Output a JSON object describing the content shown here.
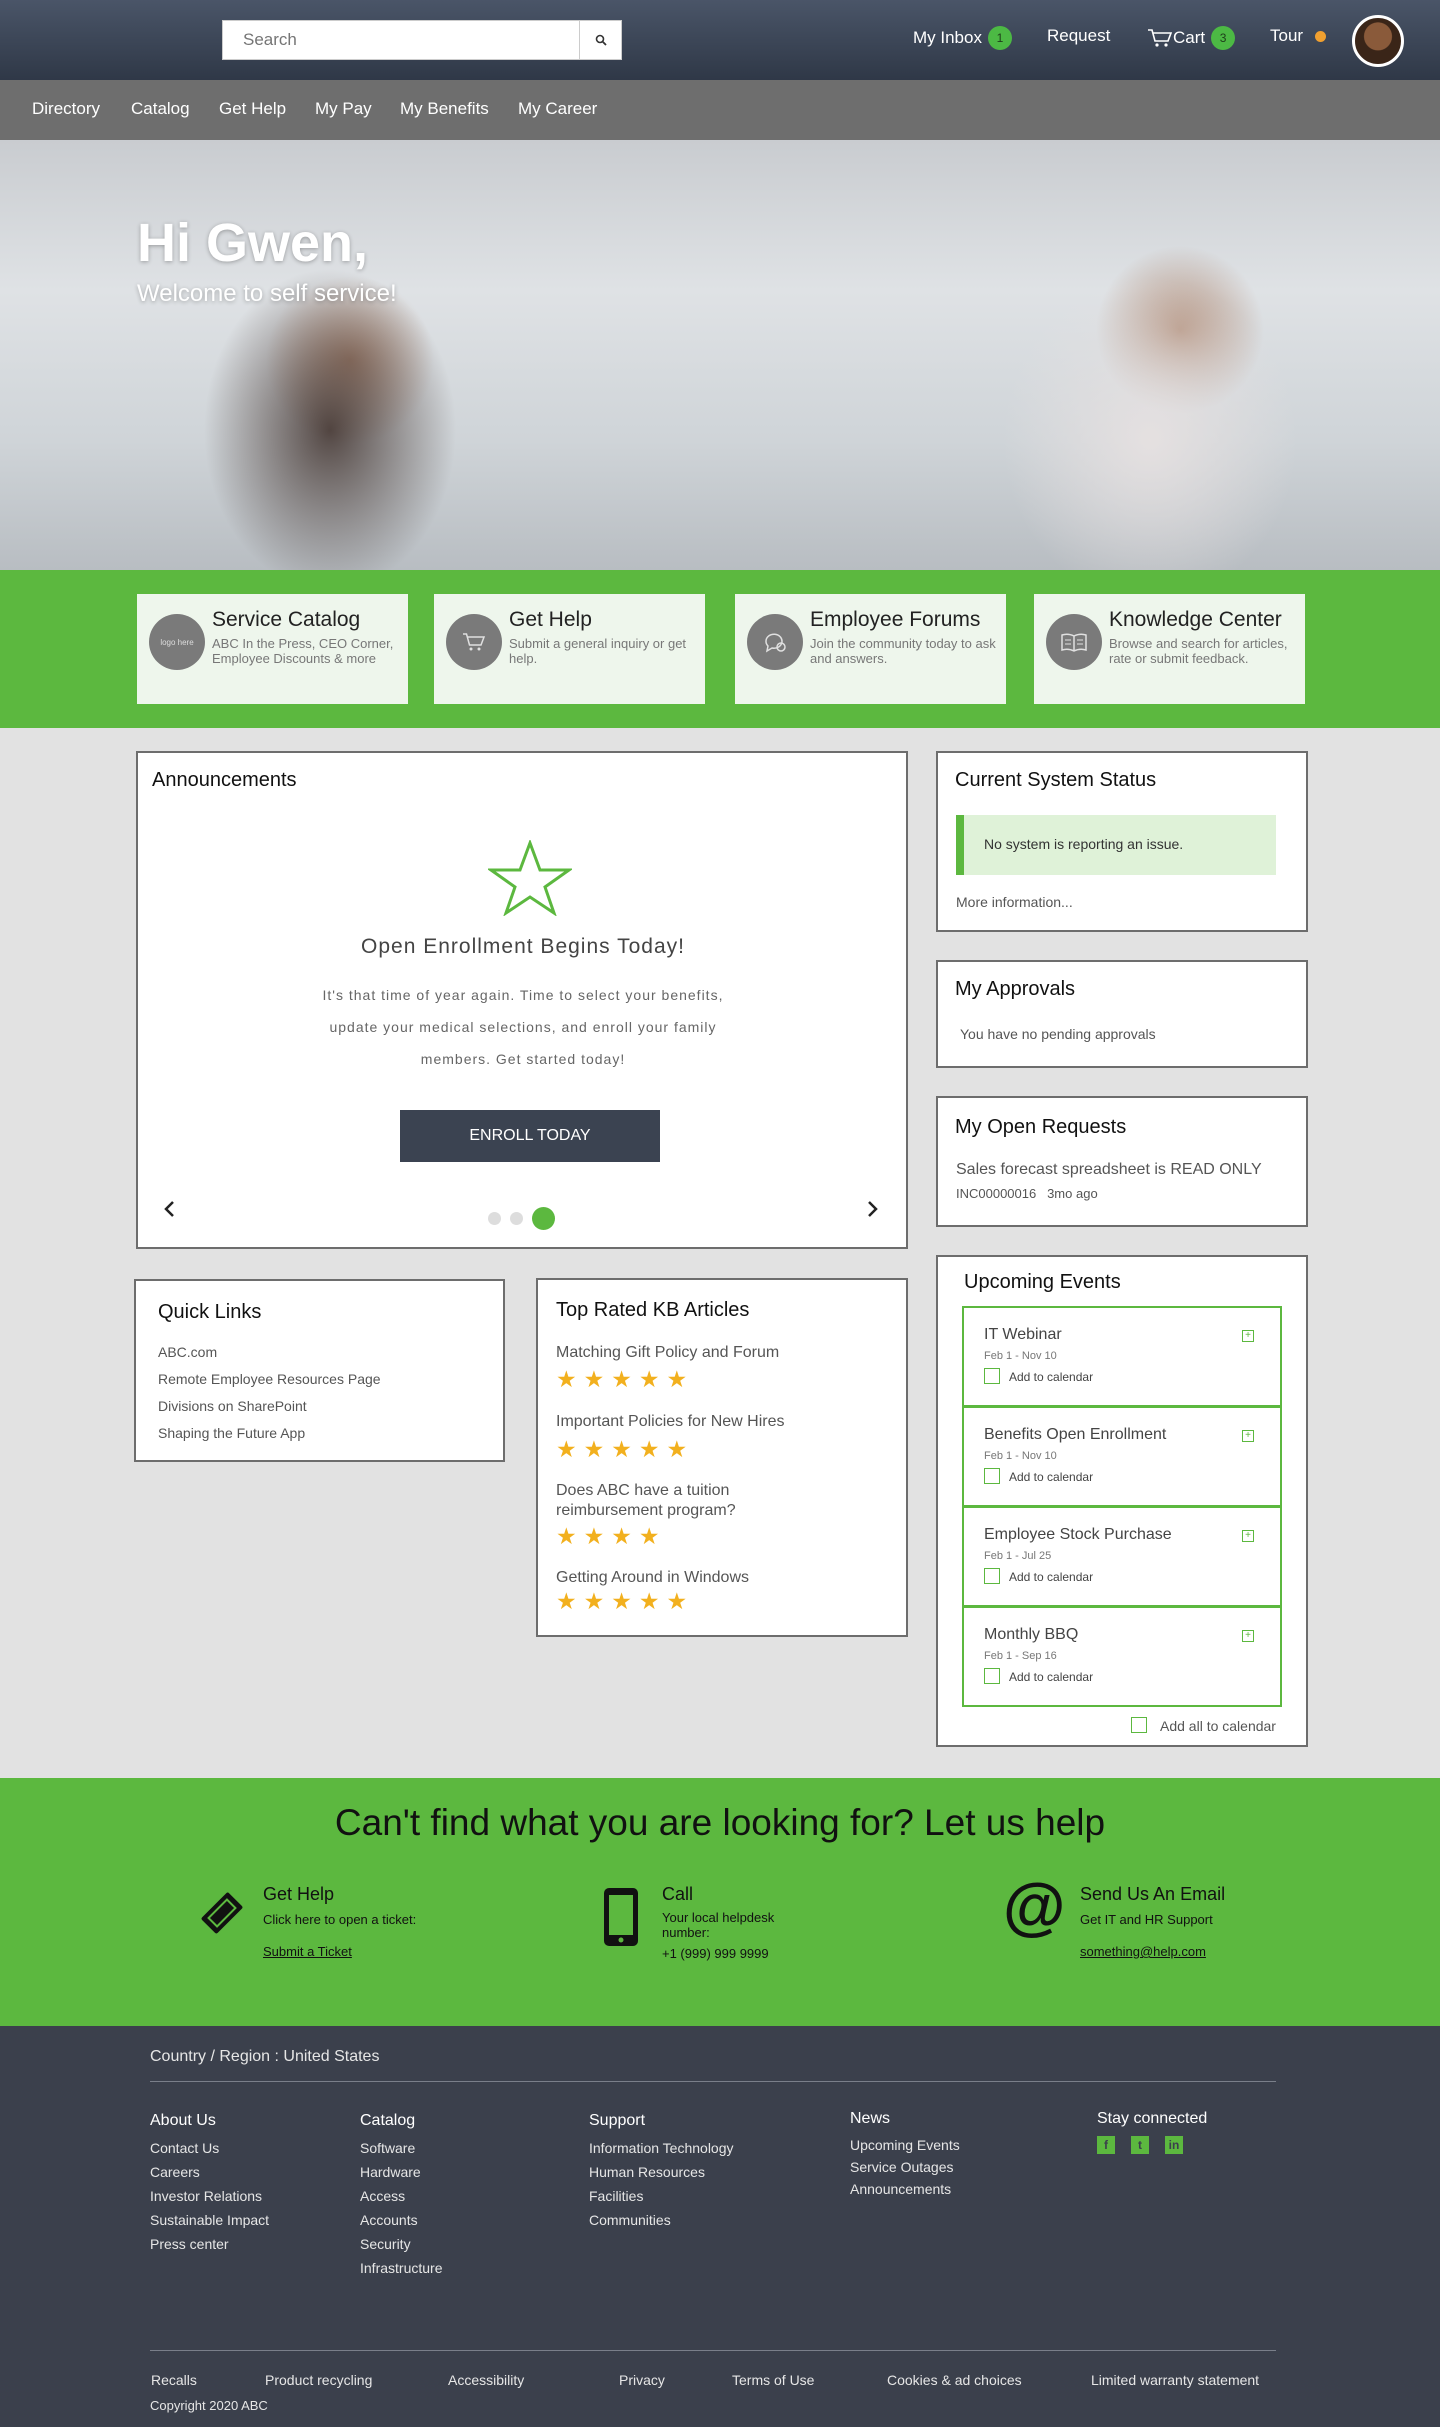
{
  "header": {
    "search_placeholder": "Search",
    "inbox_label": "My Inbox",
    "inbox_count": "1",
    "request_label": "Request",
    "cart_label": "Cart",
    "cart_count": "3",
    "tour_label": "Tour"
  },
  "nav": [
    "Directory",
    "Catalog",
    "Get Help",
    "My Pay",
    "My Benefits",
    "My Career"
  ],
  "hero": {
    "title": "Hi Gwen,",
    "subtitle": "Welcome to self service!"
  },
  "tiles": [
    {
      "title": "Service Catalog",
      "desc": "ABC In the Press, CEO Corner, Employee Discounts & more",
      "icon": "logo-placeholder",
      "icon_text": "logo here"
    },
    {
      "title": "Get Help",
      "desc": "Submit a general inquiry or get help.",
      "icon": "cart-icon"
    },
    {
      "title": "Employee Forums",
      "desc": "Join the community today to ask and answers.",
      "icon": "chat-icon"
    },
    {
      "title": "Knowledge Center",
      "desc": "Browse and search for articles, rate or submit feedback.",
      "icon": "book-icon"
    }
  ],
  "announcements": {
    "title": "Announcements",
    "headline": "Open Enrollment Begins Today!",
    "body": "It's that time of year again. Time to select your benefits, update your medical selections, and enroll your family members. Get started today!",
    "button": "ENROLL TODAY",
    "active_slide": 3,
    "slides": 3
  },
  "status": {
    "title": "Current System Status",
    "message": "No system is reporting an issue.",
    "more": "More information..."
  },
  "approvals": {
    "title": "My Approvals",
    "message": "You have no pending approvals"
  },
  "requests": {
    "title": "My Open Requests",
    "item": "Sales forecast spreadsheet is READ ONLY",
    "id": "INC00000016",
    "age": "3mo ago"
  },
  "quick_links": {
    "title": "Quick Links",
    "items": [
      "ABC.com",
      "Remote Employee Resources Page",
      "Divisions on SharePoint",
      "Shaping the Future App"
    ]
  },
  "kb": {
    "title": "Top Rated KB Articles",
    "articles": [
      {
        "title": "Matching Gift Policy and Forum",
        "rating": 5
      },
      {
        "title": "Important Policies for New Hires",
        "rating": 5
      },
      {
        "title": "Does ABC have a tuition reimbursement program?",
        "rating": 4
      },
      {
        "title": "Getting Around in Windows",
        "rating": 5
      }
    ]
  },
  "events": {
    "title": "Upcoming Events",
    "add_label": "Add to calendar",
    "add_all": "Add all to calendar",
    "items": [
      {
        "name": "IT Webinar",
        "dates": "Feb 1 - Nov 10"
      },
      {
        "name": "Benefits Open Enrollment",
        "dates": "Feb 1 - Nov 10"
      },
      {
        "name": "Employee Stock Purchase",
        "dates": "Feb 1 - Jul 25"
      },
      {
        "name": "Monthly BBQ",
        "dates": "Feb 1 - Sep 16"
      }
    ]
  },
  "help": {
    "title": "Can't find what you are looking for? Let us help",
    "get_help": {
      "title": "Get Help",
      "text": "Click here to open a ticket:",
      "link": "Submit a Ticket"
    },
    "call": {
      "title": "Call",
      "text": "Your local helpdesk number:",
      "number": "+1 (999) 999 9999"
    },
    "email": {
      "title": "Send Us An Email",
      "text": "Get IT and HR Support",
      "link": "something@help.com"
    }
  },
  "footer": {
    "region": "Country / Region : United States",
    "columns": [
      {
        "title": "About Us",
        "items": [
          "Contact Us",
          "Careers",
          "Investor Relations",
          "Sustainable Impact",
          "Press center"
        ]
      },
      {
        "title": "Catalog",
        "items": [
          "Software",
          "Hardware",
          "Access",
          "Accounts",
          "Security",
          "Infrastructure"
        ]
      },
      {
        "title": "Support",
        "items": [
          "Information Technology",
          "Human Resources",
          "Facilities",
          "Communities"
        ]
      },
      {
        "title": "News",
        "items": [
          "Upcoming Events",
          "Service Outages",
          "Announcements"
        ]
      }
    ],
    "stay_connected": "Stay connected",
    "social": [
      "facebook-icon",
      "twitter-icon",
      "linkedin-icon"
    ],
    "bottom_links": [
      "Recalls",
      "Product recycling",
      "Accessibility",
      "Privacy",
      "Terms of Use",
      "Cookies & ad choices",
      "Limited warranty statement"
    ],
    "copyright": "Copyright 2020 ABC"
  },
  "colors": {
    "accent_green": "#5cb83f",
    "header_dark": "#3b4351",
    "star": "#f2b01e",
    "tour_dot": "#f0a030"
  }
}
